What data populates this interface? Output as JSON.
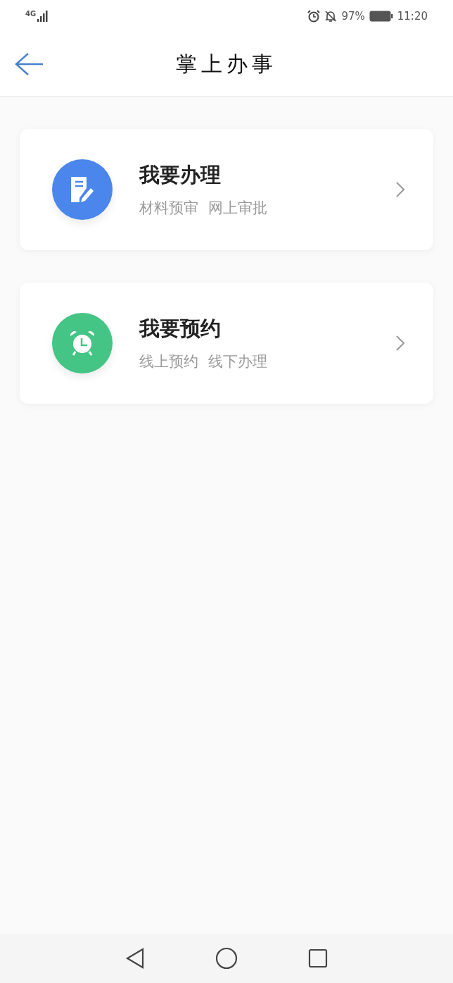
{
  "status_bar": {
    "network": "4G",
    "battery": "97%",
    "time": "11:20"
  },
  "header": {
    "title": "掌上办事"
  },
  "cards": [
    {
      "kind": "document",
      "color": "#4a86ec",
      "title": "我要办理",
      "tags": [
        "材料预审",
        "网上审批"
      ]
    },
    {
      "kind": "alarm",
      "color": "#45c585",
      "title": "我要预约",
      "tags": [
        "线上预约",
        "线下办理"
      ]
    }
  ]
}
